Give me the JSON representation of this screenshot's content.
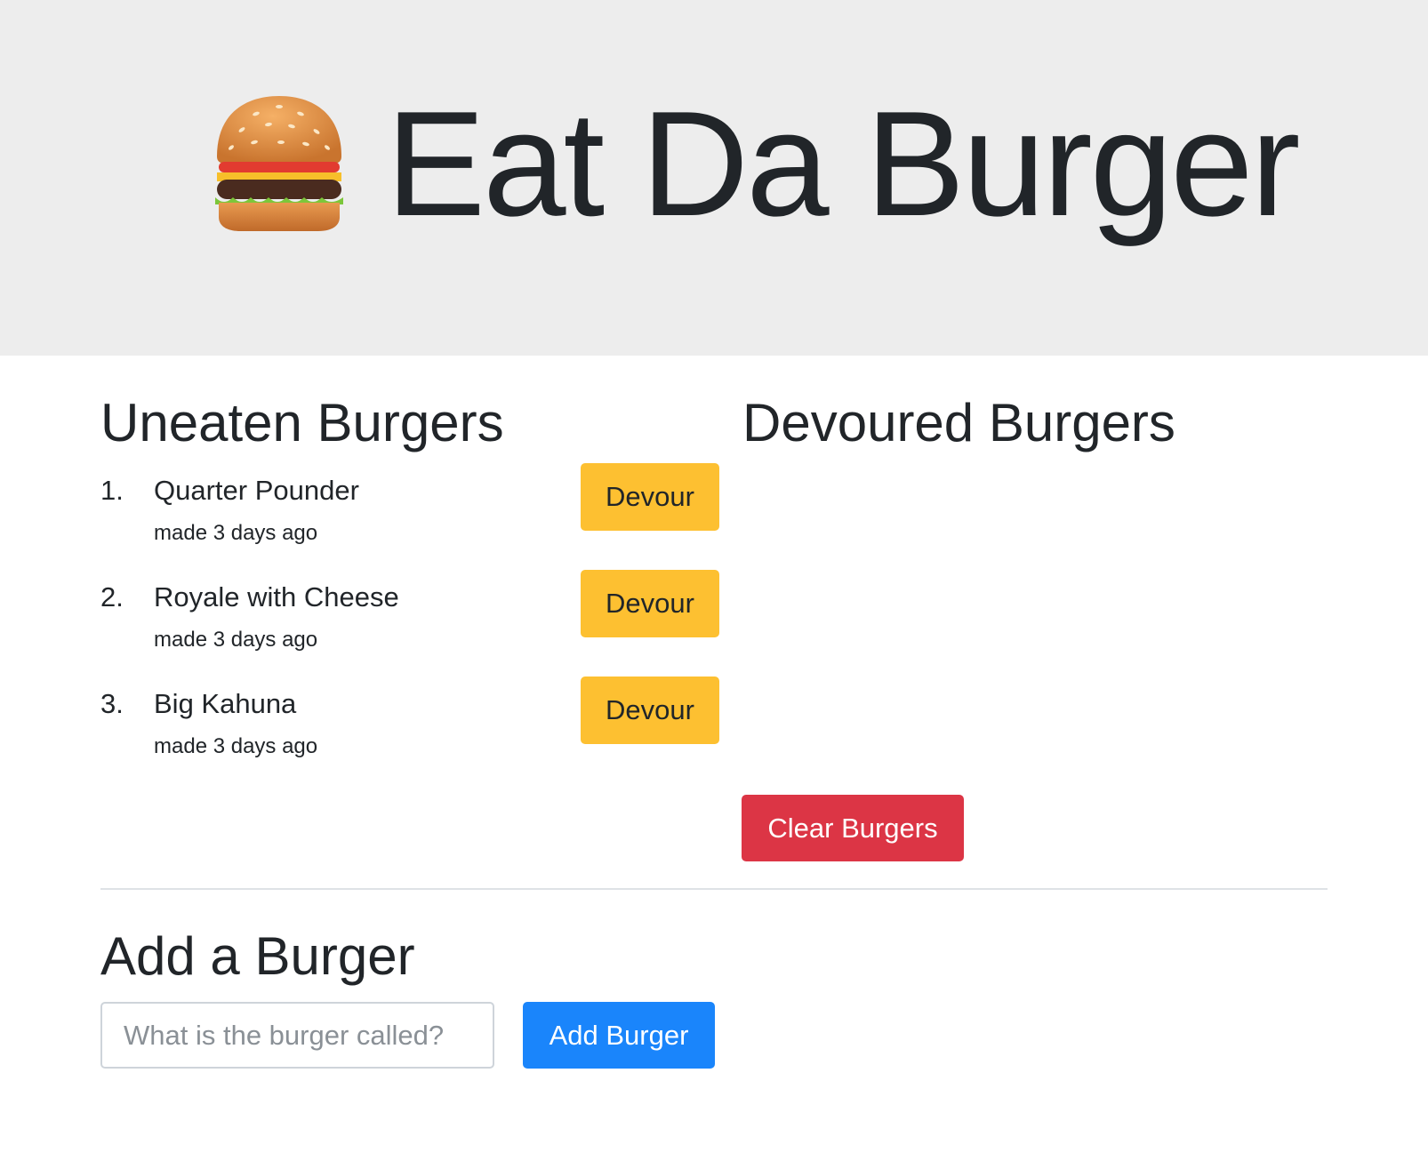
{
  "header": {
    "icon": "burger-emoji-icon",
    "title": "Eat Da Burger",
    "background": "#ededed"
  },
  "uneaten": {
    "heading": "Uneaten Burgers",
    "items": [
      {
        "number": "1.",
        "name": "Quarter Pounder",
        "meta": "made 3 days ago",
        "button": "Devour"
      },
      {
        "number": "2.",
        "name": "Royale with Cheese",
        "meta": "made 3 days ago",
        "button": "Devour"
      },
      {
        "number": "3.",
        "name": "Big Kahuna",
        "meta": "made 3 days ago",
        "button": "Devour"
      }
    ],
    "button_color": "#fdc031"
  },
  "devoured": {
    "heading": "Devoured Burgers",
    "items": [],
    "clear_button": "Clear Burgers",
    "clear_color": "#dc3545"
  },
  "add": {
    "heading": "Add a Burger",
    "input_value": "",
    "input_placeholder": "What is the burger called?",
    "submit_button": "Add Burger",
    "submit_color": "#1a85fb"
  }
}
